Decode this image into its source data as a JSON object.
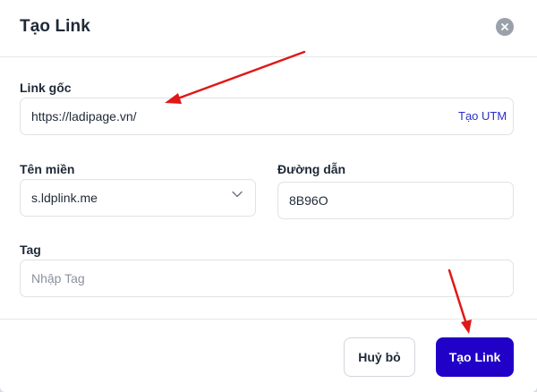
{
  "dialog": {
    "title": "Tạo Link",
    "close_icon": "close-icon"
  },
  "form": {
    "original_link": {
      "label": "Link gốc",
      "value": "https://ladipage.vn/",
      "utm_link": "Tạo UTM"
    },
    "domain": {
      "label": "Tên miền",
      "value": "s.ldplink.me",
      "icon": "chevron-down-icon"
    },
    "path": {
      "label": "Đường dẫn",
      "value": "8B96O"
    },
    "tag": {
      "label": "Tag",
      "placeholder": "Nhập Tag"
    }
  },
  "footer": {
    "cancel_label": "Huỷ bỏ",
    "create_label": "Tạo Link"
  },
  "annotations": {
    "arrow_color": "#e01818"
  },
  "colors": {
    "primary": "#2100c7",
    "link": "#2b2ec9"
  }
}
